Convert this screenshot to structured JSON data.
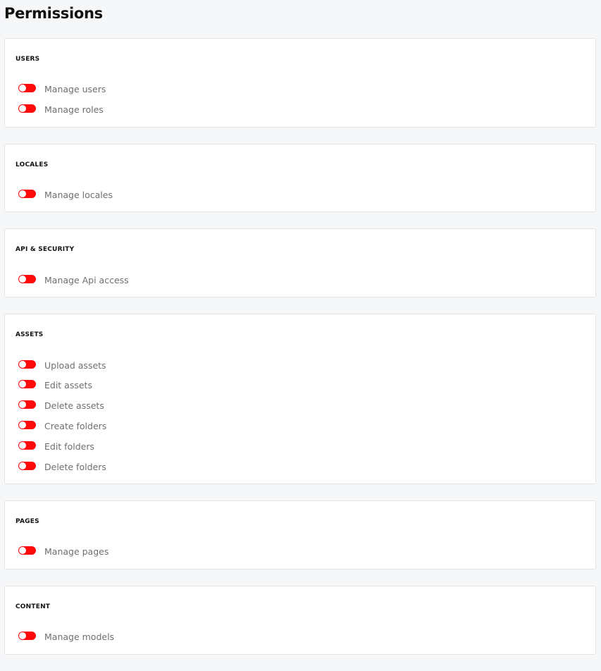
{
  "page": {
    "title": "Permissions"
  },
  "colors": {
    "toggle_off": "#ff0a0a",
    "background": "#f6f7f9",
    "card": "#ffffff"
  },
  "sections": [
    {
      "heading": "USERS",
      "items": [
        {
          "label": "Manage users",
          "enabled": false
        },
        {
          "label": "Manage roles",
          "enabled": false
        }
      ]
    },
    {
      "heading": "LOCALES",
      "items": [
        {
          "label": "Manage locales",
          "enabled": false
        }
      ]
    },
    {
      "heading": "API & SECURITY",
      "items": [
        {
          "label": "Manage Api access",
          "enabled": false
        }
      ]
    },
    {
      "heading": "ASSETS",
      "items": [
        {
          "label": "Upload assets",
          "enabled": false
        },
        {
          "label": "Edit assets",
          "enabled": false
        },
        {
          "label": "Delete assets",
          "enabled": false
        },
        {
          "label": "Create folders",
          "enabled": false
        },
        {
          "label": "Edit folders",
          "enabled": false
        },
        {
          "label": "Delete folders",
          "enabled": false
        }
      ]
    },
    {
      "heading": "PAGES",
      "items": [
        {
          "label": "Manage pages",
          "enabled": false
        }
      ]
    },
    {
      "heading": "CONTENT",
      "items": [
        {
          "label": "Manage models",
          "enabled": false
        }
      ]
    }
  ]
}
